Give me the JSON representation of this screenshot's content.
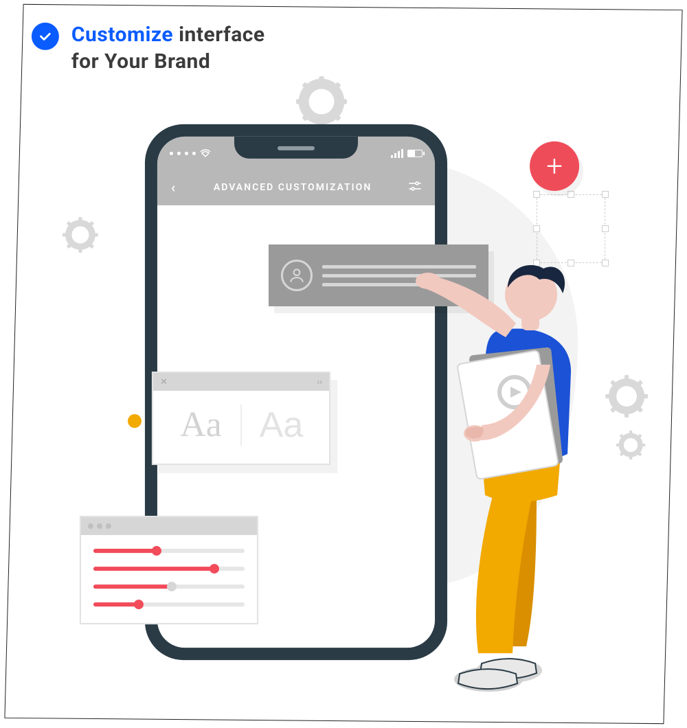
{
  "header": {
    "highlight": "Customize",
    "rest_line1": " interface",
    "line2": "for Your Brand"
  },
  "phone": {
    "app_bar_title": "ADVANCED CUSTOMIZATION"
  },
  "typography_panel": {
    "sample_serif": "Aa",
    "sample_sans": "Aa"
  },
  "sliders": [
    {
      "value_pct": 42
    },
    {
      "value_pct": 80
    },
    {
      "value_pct": 52
    },
    {
      "value_pct": 30
    }
  ],
  "plus_button": {
    "glyph": "+"
  },
  "colors": {
    "accent_blue": "#0a5cff",
    "accent_red": "#ef4c59",
    "accent_orange": "#f2a900",
    "phone_frame": "#2a3b45",
    "neutral": "#b8b8b8"
  }
}
